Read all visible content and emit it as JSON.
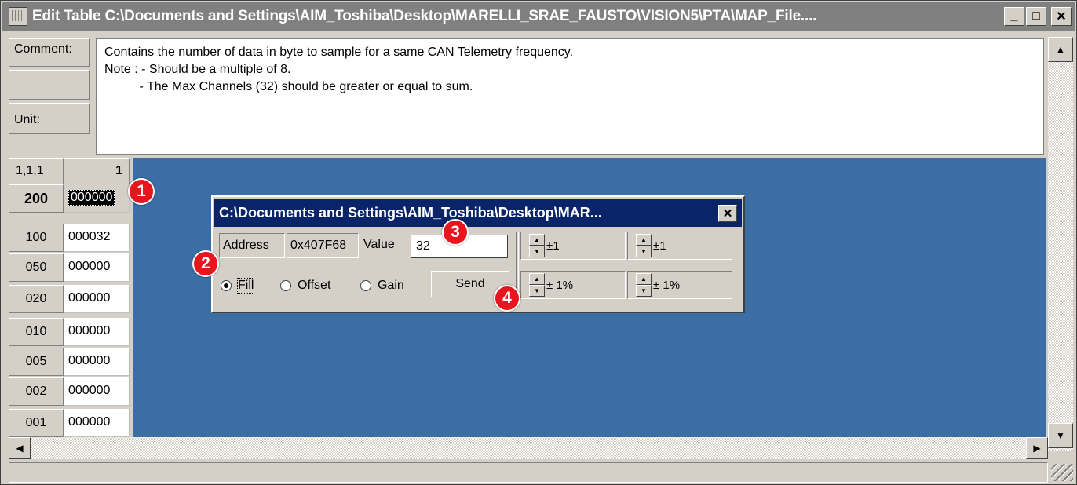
{
  "window": {
    "title": "Edit Table C:\\Documents and Settings\\AIM_Toshiba\\Desktop\\MARELLI_SRAE_FAUSTO\\VISION5\\PTA\\MAP_File....",
    "buttons": {
      "minimize": "_",
      "maximize": "□",
      "close": "✕"
    }
  },
  "info": {
    "comment_label": "Comment:",
    "unit_label": "Unit:",
    "comment_text": "Contains the number of data in byte to sample for a same CAN Telemetry frequency.\nNote : - Should be a multiple of 8.\n          - The Max Channels (32) should be greater or equal to sum."
  },
  "grid": {
    "corner": "1,1,1",
    "column_header": "1",
    "rows": [
      {
        "label": "200",
        "value": "000000",
        "selected": true
      },
      {
        "label": "100",
        "value": "000032"
      },
      {
        "label": "050",
        "value": "000000"
      },
      {
        "label": "020",
        "value": "000000"
      },
      {
        "label": "010",
        "value": "000000"
      },
      {
        "label": "005",
        "value": "000000"
      },
      {
        "label": "002",
        "value": "000000"
      },
      {
        "label": "001",
        "value": "000000"
      }
    ]
  },
  "dialog": {
    "title": "C:\\Documents and Settings\\AIM_Toshiba\\Desktop\\MAR...",
    "address_label": "Address",
    "address_value": "0x407F68",
    "value_label": "Value",
    "value_input": "32",
    "radio_fill": "Fill",
    "radio_offset": "Offset",
    "radio_gain": "Gain",
    "selected_mode": "Fill",
    "send_label": "Send",
    "step_1a": "±1",
    "step_1b": "±1",
    "step_pct_a": "± 1%",
    "step_pct_b": "± 1%"
  },
  "annotations": [
    "1",
    "2",
    "3",
    "4"
  ],
  "colors": {
    "workspace_blue": "#3a6ea5",
    "dialog_title_bg": "#0a246a",
    "badge_red": "#e8141e"
  }
}
